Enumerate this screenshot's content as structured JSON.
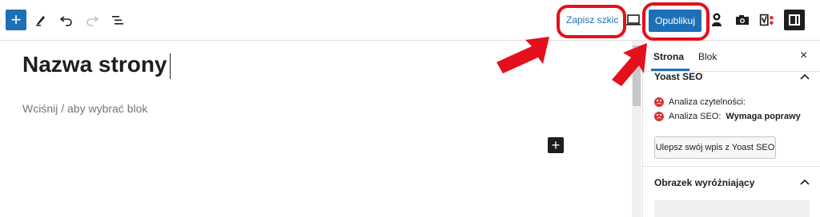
{
  "toolbar": {
    "add_block": "+",
    "save_draft": "Zapisz szkic",
    "publish": "Opublikuj"
  },
  "editor": {
    "title": "Nazwa strony",
    "placeholder": "Wciśnij / aby wybrać blok",
    "add_block_inline": "+"
  },
  "sidebar": {
    "tabs": [
      "Strona",
      "Blok"
    ],
    "close": "×",
    "yoast": {
      "title": "Yoast SEO",
      "readability_label": "Analiza czytelności:",
      "seo_label": "Analiza SEO:",
      "seo_value": "Wymaga poprawy",
      "improve_button": "Ulepsz swój wpis z Yoast SEO"
    },
    "featured_image": {
      "title": "Obrazek wyróżniający"
    }
  },
  "colors": {
    "accent": "#1e70b6",
    "highlight": "#e4101c",
    "error": "#dc3232"
  },
  "icons": [
    "plus-icon",
    "pencil-icon",
    "undo-icon",
    "redo-icon",
    "list-view-icon",
    "desktop-preview-icon",
    "user-badge-icon",
    "camera-icon",
    "yoast-icon",
    "sidebar-toggle-icon",
    "close-icon",
    "chevron-up-icon",
    "sad-face-icon"
  ]
}
